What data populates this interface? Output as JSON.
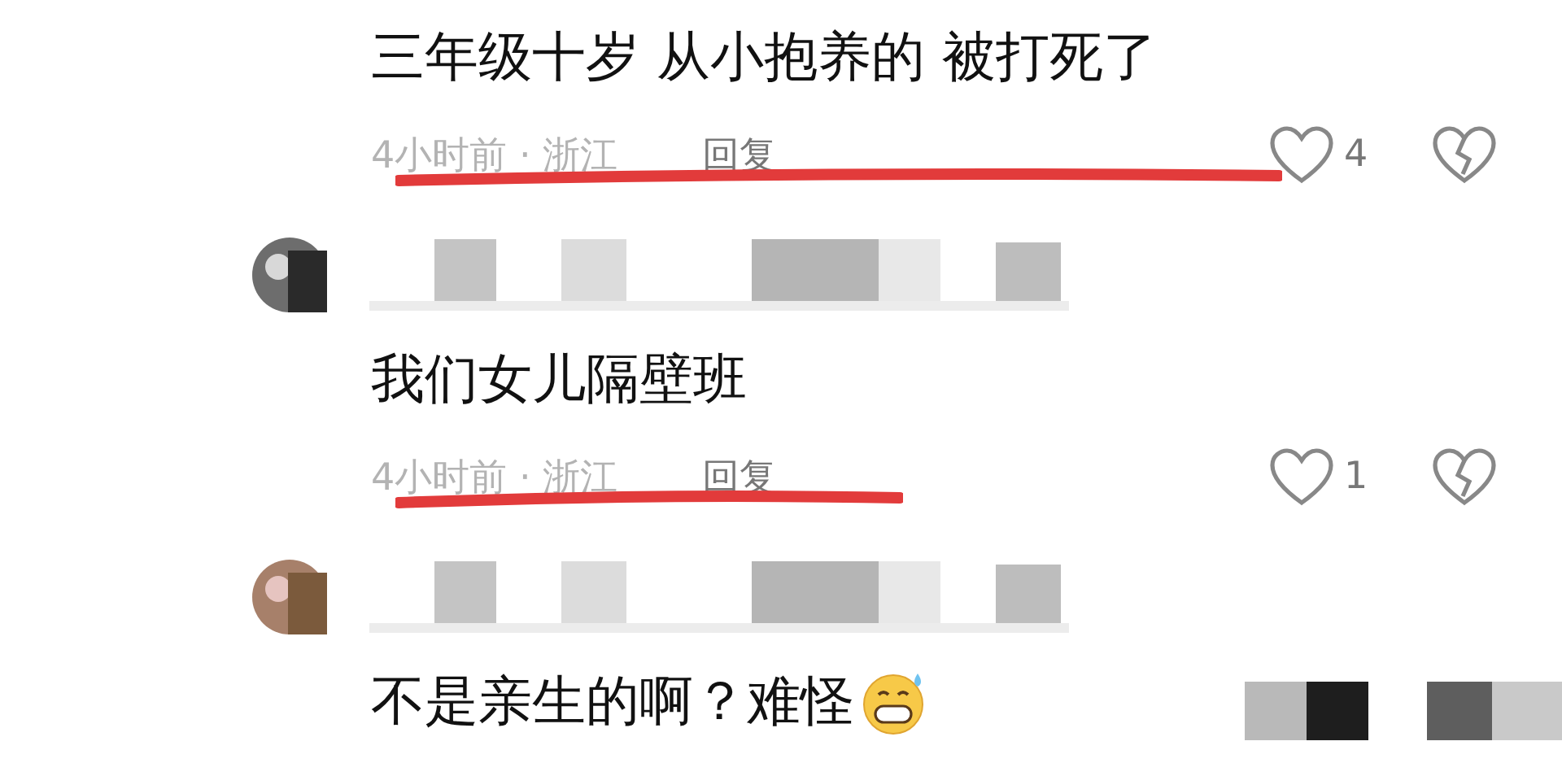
{
  "comments": [
    {
      "header": false,
      "text": "三年级十岁 从小抱养的 被打死了",
      "emoji": false,
      "meta": {
        "time": "4小时前 · 浙江",
        "reply": "回复",
        "likes": "4",
        "underline": {
          "kind": "long"
        }
      }
    },
    {
      "header": true,
      "text": "我们女儿隔壁班",
      "emoji": false,
      "meta": {
        "time": "4小时前 · 浙江",
        "reply": "回复",
        "likes": "1",
        "underline": {
          "kind": "short"
        }
      }
    },
    {
      "header": true,
      "text": "不是亲生的啊？难怪",
      "emoji": true
    }
  ]
}
